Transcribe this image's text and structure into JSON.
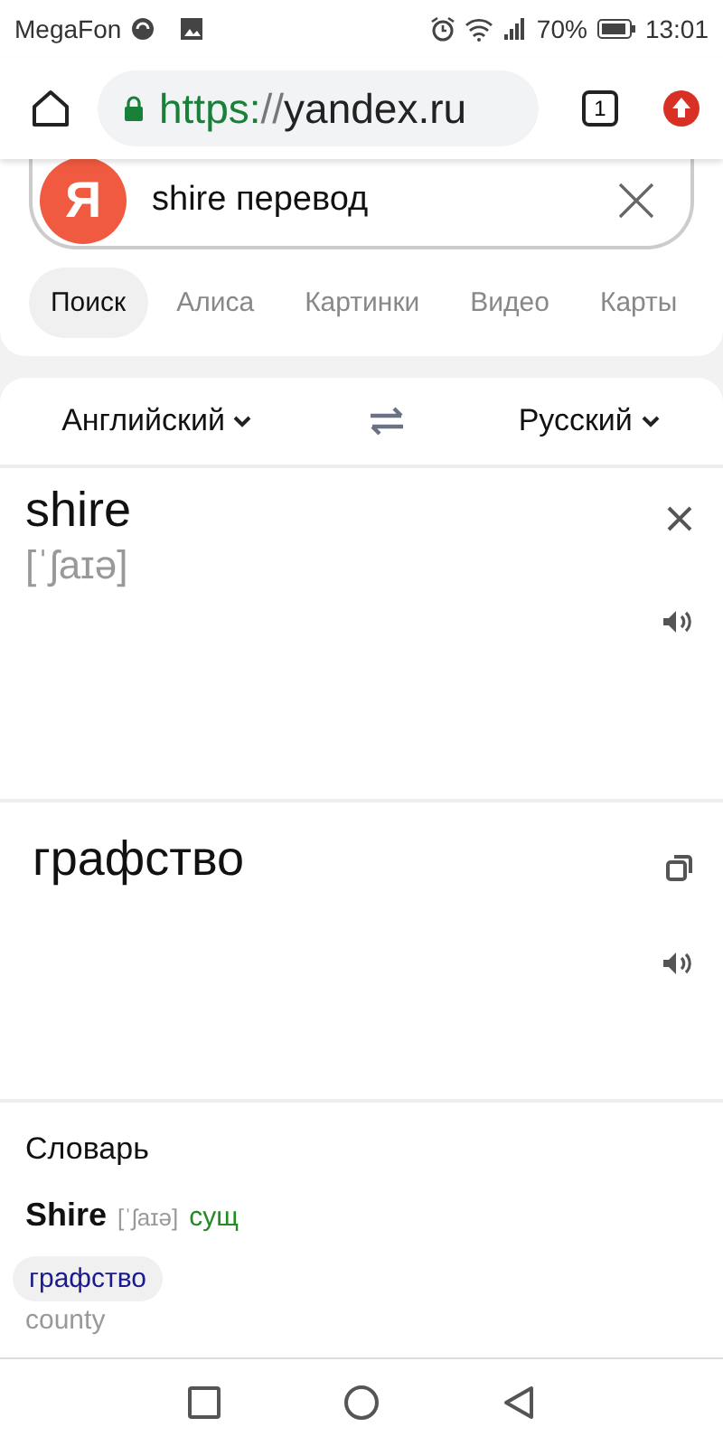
{
  "status_bar": {
    "carrier": "MegaFon",
    "battery": "70%",
    "time": "13:01"
  },
  "browser": {
    "url_scheme": "https:",
    "url_separator": "//",
    "url_host": "yandex.ru",
    "tab_count": "1"
  },
  "search": {
    "logo": "Я",
    "query": "shire перевод"
  },
  "tabs": [
    {
      "label": "Поиск",
      "selected": true
    },
    {
      "label": "Алиса",
      "selected": false
    },
    {
      "label": "Картинки",
      "selected": false
    },
    {
      "label": "Видео",
      "selected": false
    },
    {
      "label": "Карты",
      "selected": false
    }
  ],
  "translator": {
    "source_language": "Английский",
    "target_language": "Русский",
    "source_text": "shire",
    "transcription": "[ˈʃaɪə]",
    "translation": "графство"
  },
  "dictionary": {
    "title": "Словарь",
    "word": "Shire",
    "transcription": "[ˈʃaɪə]",
    "part_of_speech": "сущ",
    "translations": [
      "графство"
    ],
    "synonym": "county"
  }
}
